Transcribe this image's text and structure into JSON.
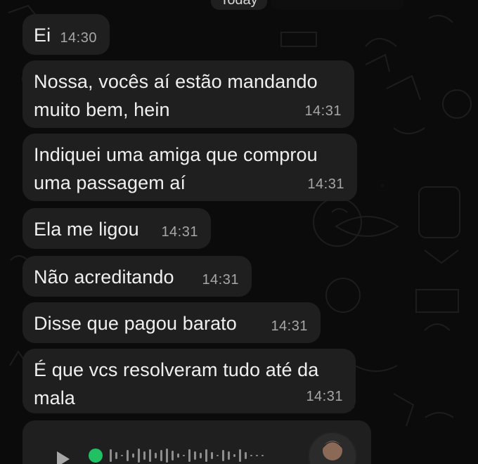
{
  "date_label": "Today",
  "messages": [
    {
      "text": "Ei",
      "time": "14:30"
    },
    {
      "text": "Nossa, vocês aí estão mandando muito bem, hein",
      "time": "14:31"
    },
    {
      "text": "Indiquei uma amiga que comprou uma passagem aí",
      "time": "14:31"
    },
    {
      "text": "Ela me ligou",
      "time": "14:31"
    },
    {
      "text": "Não acreditando",
      "time": "14:31"
    },
    {
      "text": "Disse que pagou barato",
      "time": "14:31"
    },
    {
      "text": "É que vcs resolveram tudo até da mala",
      "time": "14:31"
    }
  ],
  "audio": {
    "play_icon": "play-icon",
    "progress_color": "#21c063"
  },
  "colors": {
    "background": "#0b0b0b",
    "bubble": "#1f1f1f",
    "text": "#efefef",
    "time": "#a7a7a7",
    "accent": "#21c063"
  }
}
